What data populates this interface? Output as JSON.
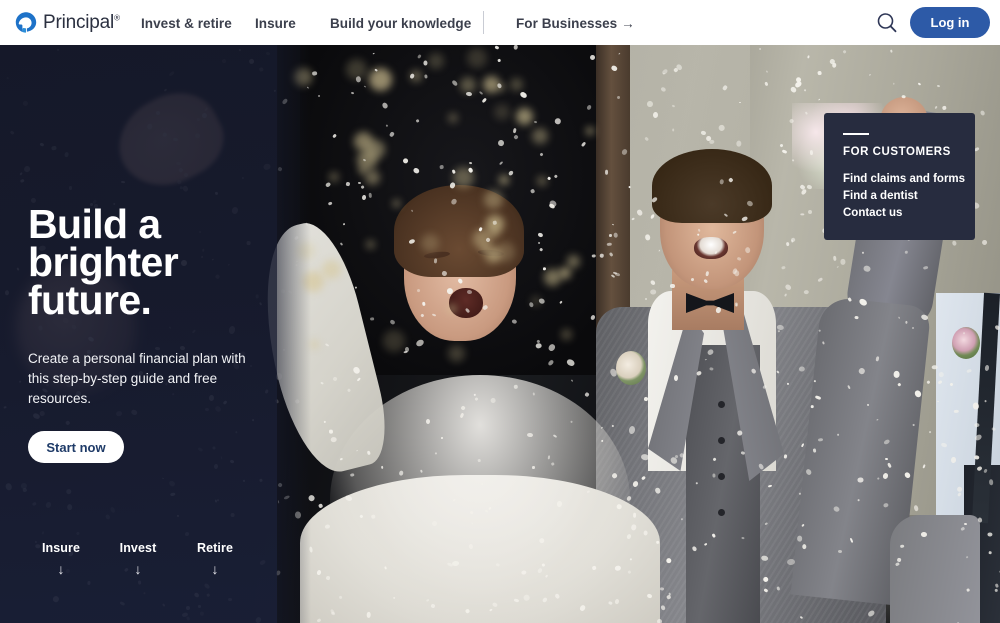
{
  "header": {
    "logo": {
      "name": "Principal",
      "mark": "principal-logo-icon",
      "trademark": "®"
    },
    "nav": [
      {
        "id": "invest-retire",
        "label": "Invest & retire"
      },
      {
        "id": "insure",
        "label": "Insure"
      },
      {
        "id": "build-knowledge",
        "label": "Build your knowledge"
      }
    ],
    "business_link": {
      "label": "For Businesses",
      "arrow": "→"
    },
    "search": {
      "icon": "search-icon",
      "label": "Search"
    },
    "login": {
      "label": "Log in"
    }
  },
  "hero": {
    "title": "Build a brighter future.",
    "title_lines": [
      "Build a",
      "brighter",
      "future."
    ],
    "subtitle": "Create a personal financial plan with this step-by-step guide and free resources.",
    "cta": {
      "label": "Start now"
    },
    "image_alt": "Newlywed couple celebrating with confetti",
    "quick_links": [
      {
        "label": "Insure",
        "arrow": "↓"
      },
      {
        "label": "Invest",
        "arrow": "↓"
      },
      {
        "label": "Retire",
        "arrow": "↓"
      }
    ]
  },
  "customer_panel": {
    "heading": "FOR CUSTOMERS",
    "links": [
      {
        "label": "Find claims and forms"
      },
      {
        "label": "Find a dentist"
      },
      {
        "label": "Contact us"
      }
    ]
  },
  "colors": {
    "brand_blue": "#2d5aa7",
    "logo_blue": "#1e72c8",
    "panel_navy": "#272c3f",
    "overlay_navy": "#161a2c",
    "text_dark": "#3b3f4c",
    "cta_text": "#1f3b68",
    "white": "#ffffff"
  }
}
